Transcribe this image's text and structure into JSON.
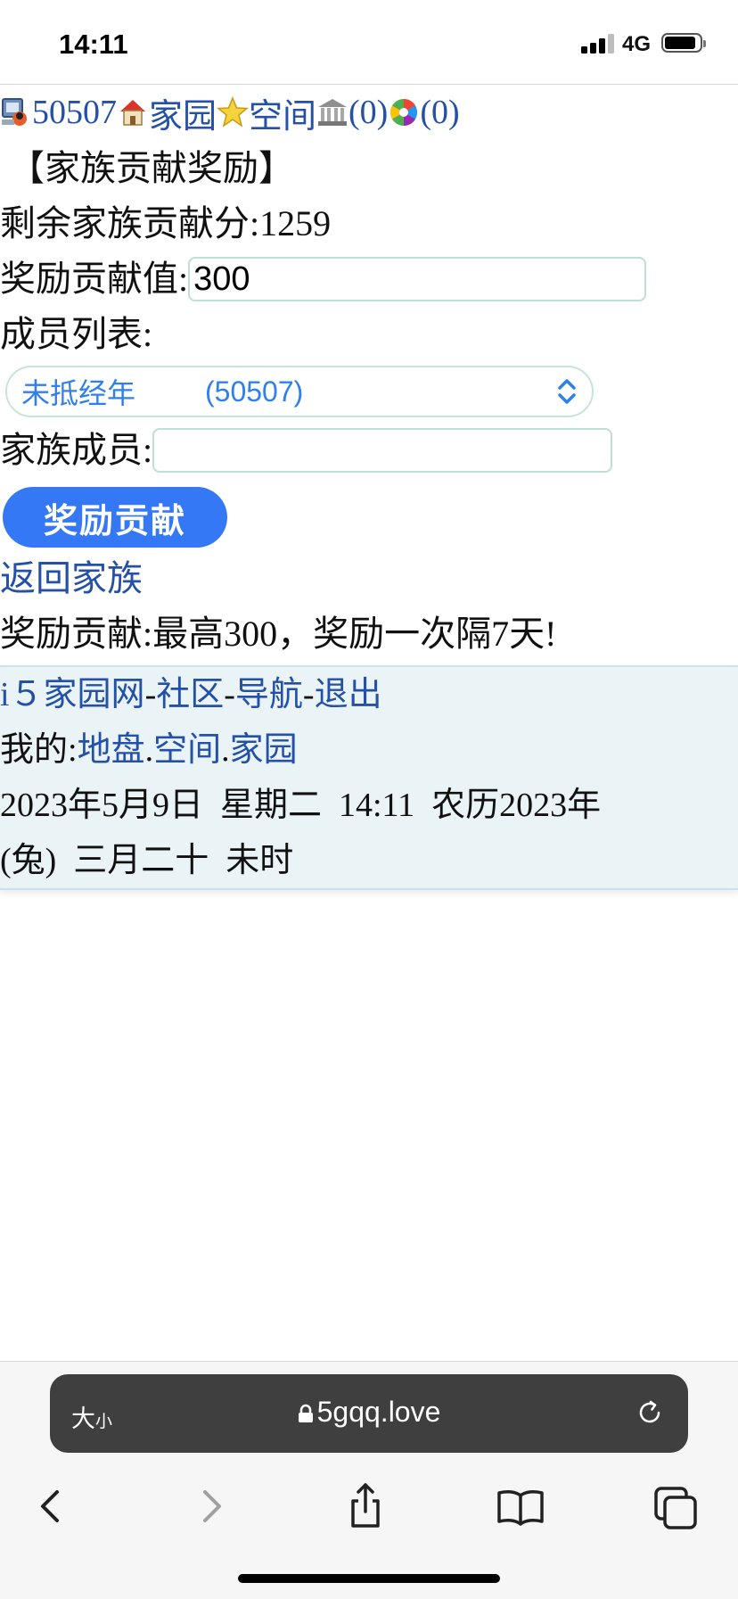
{
  "status_bar": {
    "time": "14:11",
    "network": "4G"
  },
  "top_nav": {
    "user_id": "50507",
    "home_label": "家园",
    "space_label": "空间",
    "bank_count": "(0)",
    "photo_count": "(0)"
  },
  "page": {
    "heading": "【家族贡献奖励】",
    "remaining_label": "剩余家族贡献分:",
    "remaining_value": "1259",
    "reward_value_label": "奖励贡献值:",
    "reward_value_input": "300",
    "member_list_label": "成员列表:",
    "member_select": {
      "name": "未抵经年",
      "id": "(50507)"
    },
    "family_member_label": "家族成员:",
    "family_member_input": "",
    "reward_button": "奖励贡献",
    "back_link": "返回家族",
    "note": "奖励贡献:最高300，奖励一次隔7天!"
  },
  "footer": {
    "site_link": "i５家园网",
    "sep": "-",
    "community_link": "社区",
    "nav_link": "导航",
    "logout_link": "退出",
    "mine_label": "我的:",
    "land_link": "地盘",
    "dot": ".",
    "space_link": "空间",
    "home_link": "家园",
    "datetime_line1": "2023年5月9日  星期二  14:11  农历2023年",
    "datetime_line2": "(兔)  三月二十  未时"
  },
  "browser": {
    "text_size_big": "大",
    "text_size_small": "小",
    "url": "5gqq.love"
  },
  "colors": {
    "link": "#2450a8",
    "button": "#3478f6",
    "select_text": "#2f80ed",
    "footer_bg": "#eaf4f7"
  }
}
